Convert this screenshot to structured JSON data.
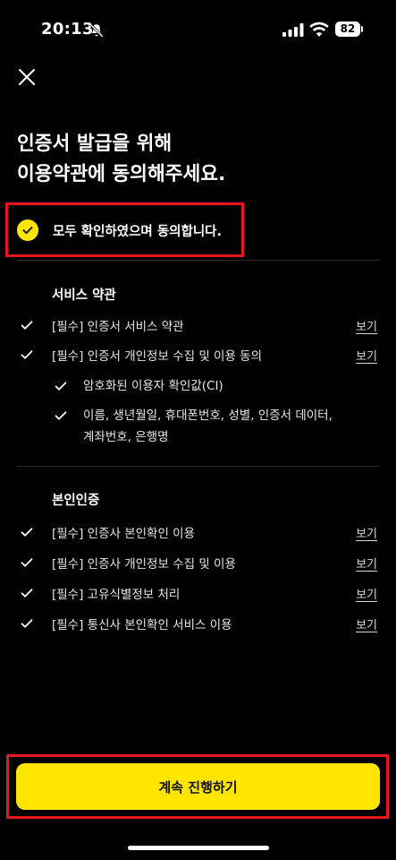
{
  "status_bar": {
    "time": "20:13",
    "battery": "82"
  },
  "header": {
    "title_line1": "인증서 발급을 위해",
    "title_line2": "이용약관에 동의해주세요."
  },
  "agree_all": {
    "label": "모두 확인하였으며 동의합니다.",
    "checked": true
  },
  "sections": {
    "service": {
      "title": "서비스 약관",
      "items": [
        {
          "label": "[필수] 인증서 서비스 약관",
          "link": "보기"
        },
        {
          "label": "[필수] 인증서 개인정보 수집 및 이용 동의",
          "link": "보기"
        }
      ],
      "sub_items": [
        {
          "label": "암호화된 이용자 확인값(CI)"
        },
        {
          "label": "이름, 생년월일, 휴대폰번호, 성별, 인증서 데이터, 계좌번호, 은행명"
        }
      ]
    },
    "identity": {
      "title": "본인인증",
      "items": [
        {
          "label": "[필수] 인증사 본인확인 이용",
          "link": "보기"
        },
        {
          "label": "[필수] 인증사 개인정보 수집 및 이용",
          "link": "보기"
        },
        {
          "label": "[필수] 고유식별정보 처리",
          "link": "보기"
        },
        {
          "label": "[필수] 통신사 본인확인 서비스 이용",
          "link": "보기"
        }
      ]
    }
  },
  "continue_button": {
    "label": "계속 진행하기"
  },
  "colors": {
    "accent": "#fee500",
    "highlight": "#e8141e",
    "background": "#000000"
  }
}
